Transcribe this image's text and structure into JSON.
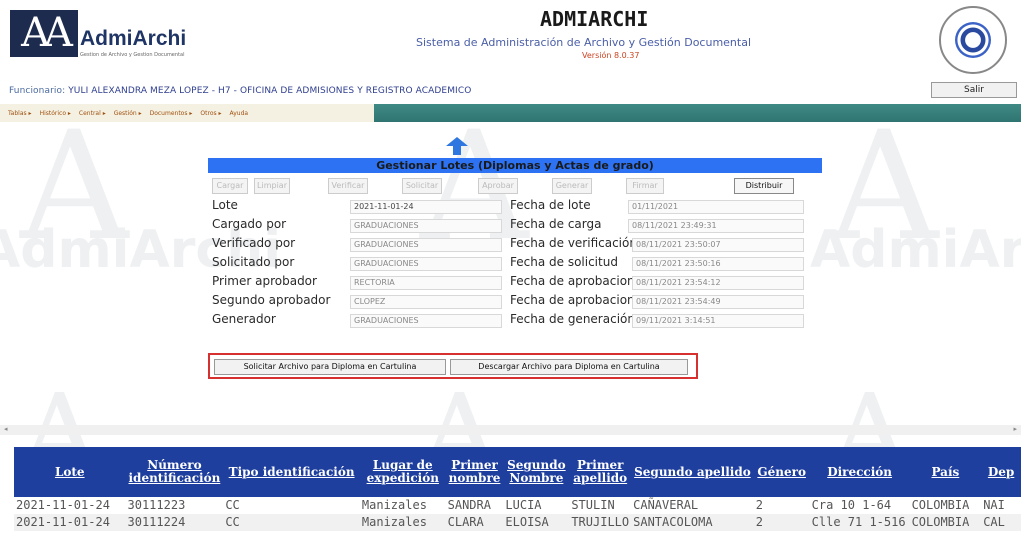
{
  "logo": {
    "text": "AdmiArchi",
    "tagline": "Gestion de Archivo y Gestion Documental"
  },
  "app": {
    "title": "ADMIARCHI",
    "subtitle": "Sistema de Administración de Archivo y Gestión Documental",
    "version": "Versión 8.0.37"
  },
  "session": {
    "label": "Funcionario:",
    "value": "YULI ALEXANDRA MEZA LOPEZ - H7 - OFICINA DE ADMISIONES Y REGISTRO ACADEMICO",
    "logout_label": "Salir"
  },
  "menu": {
    "items": [
      "Tablas",
      "Histórico",
      "Central",
      "Gestión",
      "Documentos",
      "Otros",
      "Ayuda"
    ]
  },
  "panel": {
    "title": "Gestionar Lotes (Diplomas y Actas de grado)",
    "buttons": [
      {
        "label": "Cargar",
        "enabled": false
      },
      {
        "label": "Limpiar",
        "enabled": false
      },
      {
        "label": "Verificar",
        "enabled": false
      },
      {
        "label": "Solicitar",
        "enabled": false
      },
      {
        "label": "Aprobar",
        "enabled": false
      },
      {
        "label": "Generar",
        "enabled": false
      },
      {
        "label": "Firmar",
        "enabled": false
      },
      {
        "label": "Distribuir",
        "enabled": true
      }
    ],
    "left_fields": [
      {
        "label": "Lote",
        "value": "2021-11-01-24"
      },
      {
        "label": "Cargado por",
        "value": "GRADUACIONES"
      },
      {
        "label": "Verificado por",
        "value": "GRADUACIONES"
      },
      {
        "label": "Solicitado por",
        "value": "GRADUACIONES"
      },
      {
        "label": "Primer aprobador",
        "value": "RECTORIA"
      },
      {
        "label": "Segundo aprobador",
        "value": "CLOPEZ"
      },
      {
        "label": "Generador",
        "value": "GRADUACIONES"
      }
    ],
    "right_fields": [
      {
        "label": "Fecha de lote",
        "value": "01/11/2021"
      },
      {
        "label": "Fecha de carga",
        "value": "08/11/2021 23:49:31"
      },
      {
        "label": "Fecha de verificación",
        "value": "08/11/2021 23:50:07"
      },
      {
        "label": "Fecha de solicitud",
        "value": "08/11/2021 23:50:16"
      },
      {
        "label": "Fecha de aprobacion",
        "value": "08/11/2021 23:54:12"
      },
      {
        "label": "Fecha de aprobacion",
        "value": "08/11/2021 23:54:49"
      },
      {
        "label": "Fecha de generación",
        "value": "09/11/2021 3:14:51"
      }
    ],
    "action_request_label": "Solicitar Archivo para Diploma en Cartulina",
    "action_download_label": "Descargar Archivo para Diploma en Cartulina"
  },
  "table": {
    "headers": [
      "Lote",
      "Número identificación",
      "Tipo identificación",
      "Lugar de expedición",
      "Primer nombre",
      "Segundo Nombre",
      "Primer apellido",
      "Segundo apellido",
      "Género",
      "Dirección",
      "País",
      "Dep"
    ],
    "rows": [
      [
        "2021-11-01-24",
        "30111223",
        "CC",
        "Manizales",
        "SANDRA",
        "LUCIA",
        "STULIN",
        "CAÑAVERAL",
        "2",
        "Cra 10 1-64",
        "COLOMBIA",
        "NAI"
      ],
      [
        "2021-11-01-24",
        "30111224",
        "CC",
        "Manizales",
        "CLARA",
        "ELOISA",
        "TRUJILLO",
        "SANTACOLOMA",
        "2",
        "Clle 71 1-516",
        "COLOMBIA",
        "CAL"
      ]
    ]
  },
  "colors": {
    "panel_title_bg": "#2d72f2",
    "table_header_bg": "#1f3f9e",
    "menubar_bg": "#2f7470",
    "highlight_border": "#d63030"
  }
}
